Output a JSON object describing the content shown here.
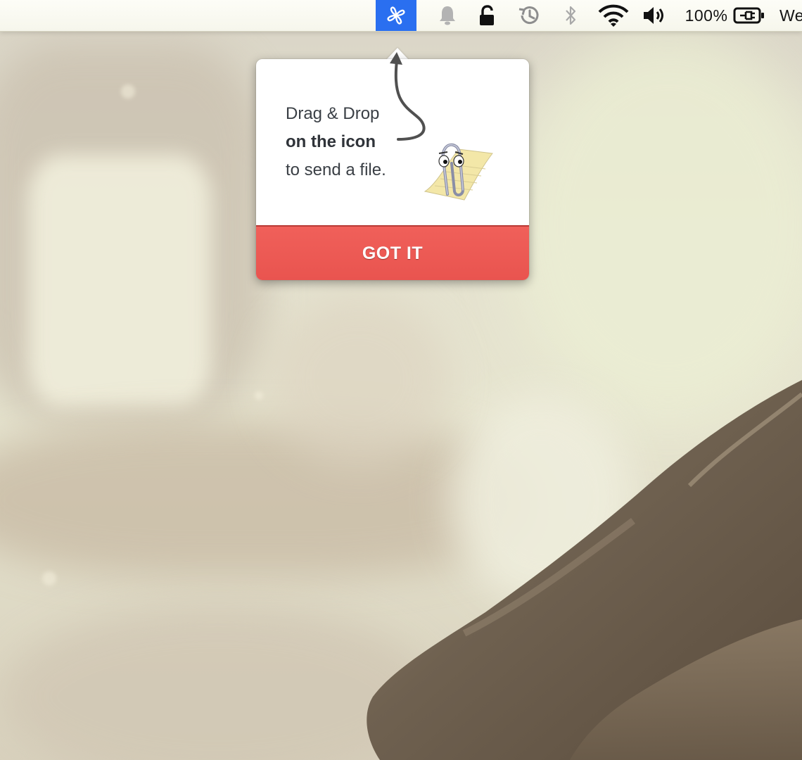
{
  "menubar": {
    "app_icon": "pinwheel-icon",
    "icons": [
      "notification-bell-icon",
      "lock-icon",
      "time-machine-icon",
      "bluetooth-icon",
      "wifi-icon",
      "volume-icon"
    ],
    "battery_percent": "100%",
    "battery_icon": "battery-charging-icon",
    "clock_partial": "We",
    "active_color": "#2a6ff0"
  },
  "popover": {
    "line1": "Drag & Drop",
    "line2": "on the icon",
    "line3": "to send a file.",
    "button_label": "GOT IT",
    "button_color": "#ef5d58",
    "illustration": "paperclip-assistant"
  }
}
